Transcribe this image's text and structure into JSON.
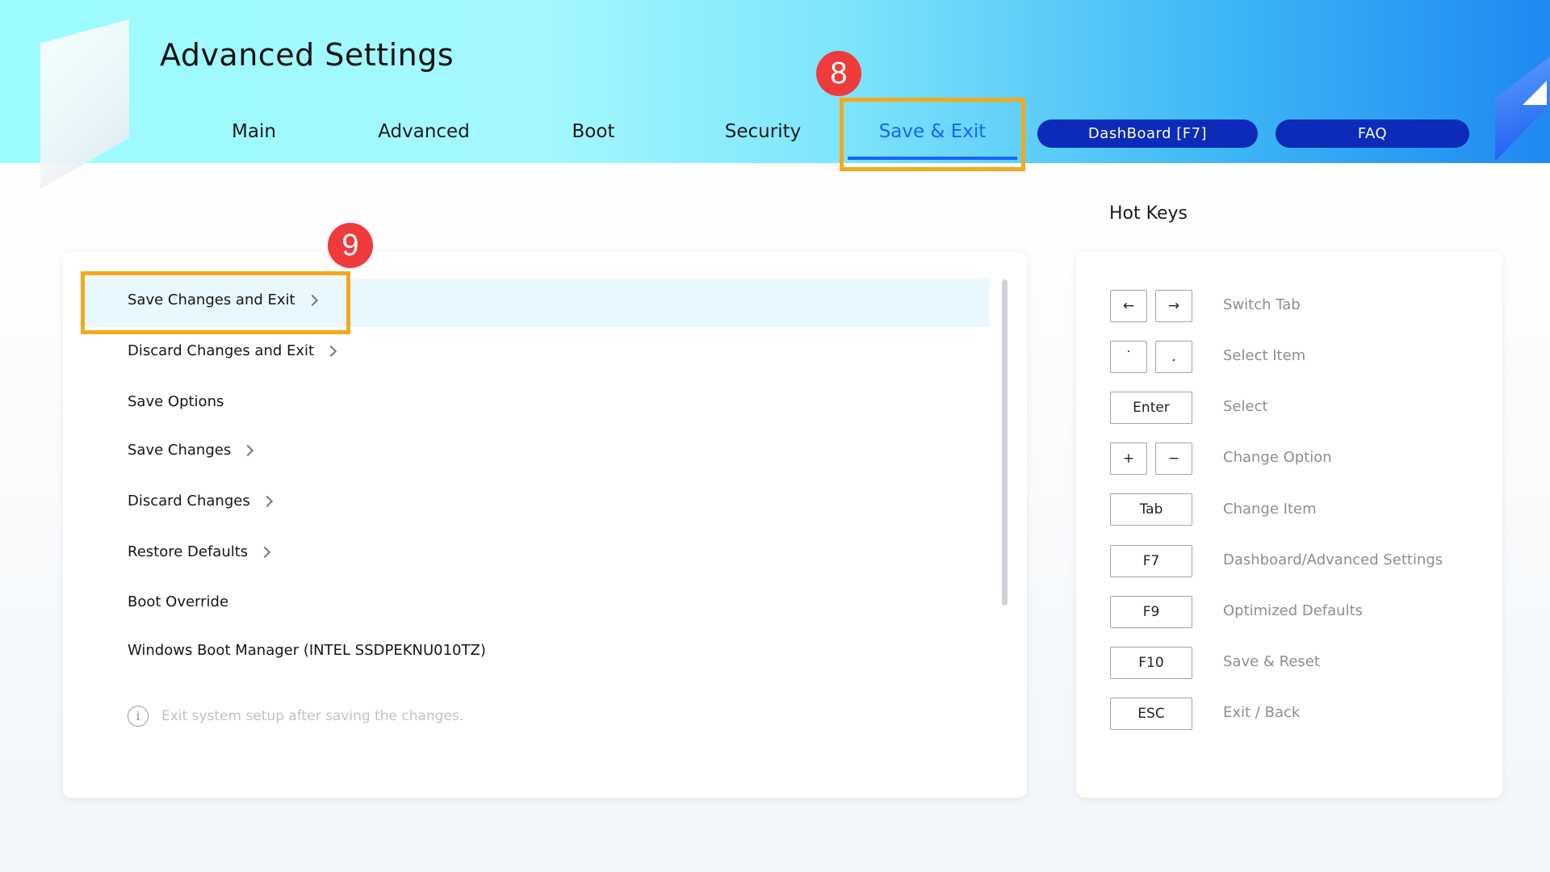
{
  "app": {
    "title": "Advanced Settings"
  },
  "tabs": [
    {
      "label": "Main",
      "active": false
    },
    {
      "label": "Advanced",
      "active": false
    },
    {
      "label": "Boot",
      "active": false
    },
    {
      "label": "Security",
      "active": false
    },
    {
      "label": "Save & Exit",
      "active": true
    }
  ],
  "header_buttons": {
    "dashboard": "DashBoard [F7]",
    "faq": "FAQ"
  },
  "annotations": {
    "tab_step": "8",
    "row_step": "9"
  },
  "menu": {
    "items": [
      {
        "label": "Save Changes and Exit",
        "has_submenu": true,
        "selected": true
      },
      {
        "label": "Discard Changes and Exit",
        "has_submenu": true,
        "selected": false
      },
      {
        "label": "Save Options",
        "has_submenu": false,
        "selected": false
      },
      {
        "label": "Save Changes",
        "has_submenu": true,
        "selected": false
      },
      {
        "label": "Discard Changes",
        "has_submenu": true,
        "selected": false
      },
      {
        "label": "Restore Defaults",
        "has_submenu": true,
        "selected": false
      },
      {
        "label": "Boot Override",
        "has_submenu": false,
        "selected": false
      },
      {
        "label": "Windows Boot Manager (INTEL SSDPEKNU010TZ)",
        "has_submenu": false,
        "selected": false
      }
    ],
    "info_text": "Exit system setup after saving the changes."
  },
  "hotkeys": {
    "title": "Hot Keys",
    "rows": [
      {
        "keys": [
          "←",
          "→"
        ],
        "label": "Switch Tab"
      },
      {
        "keys": [
          "˙",
          "."
        ],
        "label": "Select Item"
      },
      {
        "keys": [
          "Enter"
        ],
        "label": "Select"
      },
      {
        "keys": [
          "+",
          "−"
        ],
        "label": "Change Option"
      },
      {
        "keys": [
          "Tab"
        ],
        "label": "Change Item"
      },
      {
        "keys": [
          "F7"
        ],
        "label": "Dashboard/Advanced Settings"
      },
      {
        "keys": [
          "F9"
        ],
        "label": "Optimized Defaults"
      },
      {
        "keys": [
          "F10"
        ],
        "label": "Save & Reset"
      },
      {
        "keys": [
          "ESC"
        ],
        "label": "Exit / Back"
      }
    ]
  },
  "colors": {
    "accent": "#1864ff",
    "highlight": "#f5a81c",
    "badge": "#ef3b3b",
    "pill": "#0b2bb8"
  }
}
